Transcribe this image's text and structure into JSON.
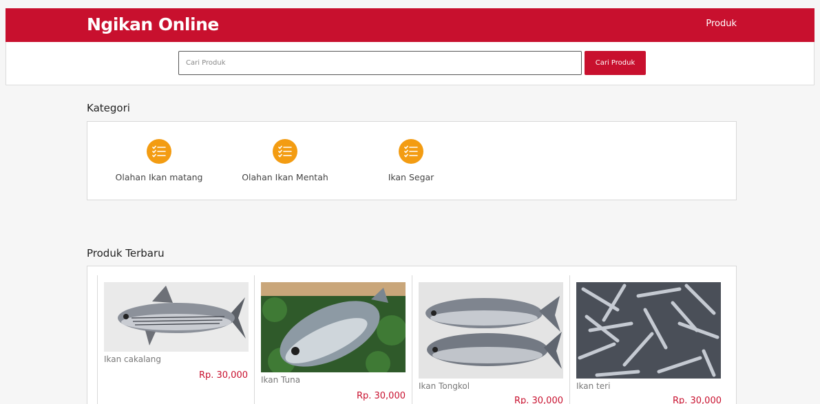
{
  "header": {
    "brand": "Ngikan Online",
    "nav_produk": "Produk"
  },
  "search": {
    "placeholder": "Cari Produk",
    "value": "",
    "button_label": "Cari Produk"
  },
  "kategori": {
    "title": "Kategori",
    "items": [
      {
        "label": "Olahan Ikan matang",
        "icon": "checklist-icon"
      },
      {
        "label": "Olahan Ikan Mentah",
        "icon": "checklist-icon"
      },
      {
        "label": "Ikan Segar",
        "icon": "checklist-icon"
      }
    ]
  },
  "produk": {
    "title": "Produk Terbaru",
    "items": [
      {
        "name": "Ikan cakalang",
        "price": "Rp. 30,000"
      },
      {
        "name": "Ikan Tuna",
        "price": "Rp. 30,000"
      },
      {
        "name": "Ikan Tongkol",
        "price": "Rp. 30,000"
      },
      {
        "name": "Ikan teri",
        "price": "Rp. 30,000"
      }
    ]
  },
  "colors": {
    "brand": "#c8102e",
    "category_icon": "#f39c12",
    "price": "#c8102e"
  }
}
